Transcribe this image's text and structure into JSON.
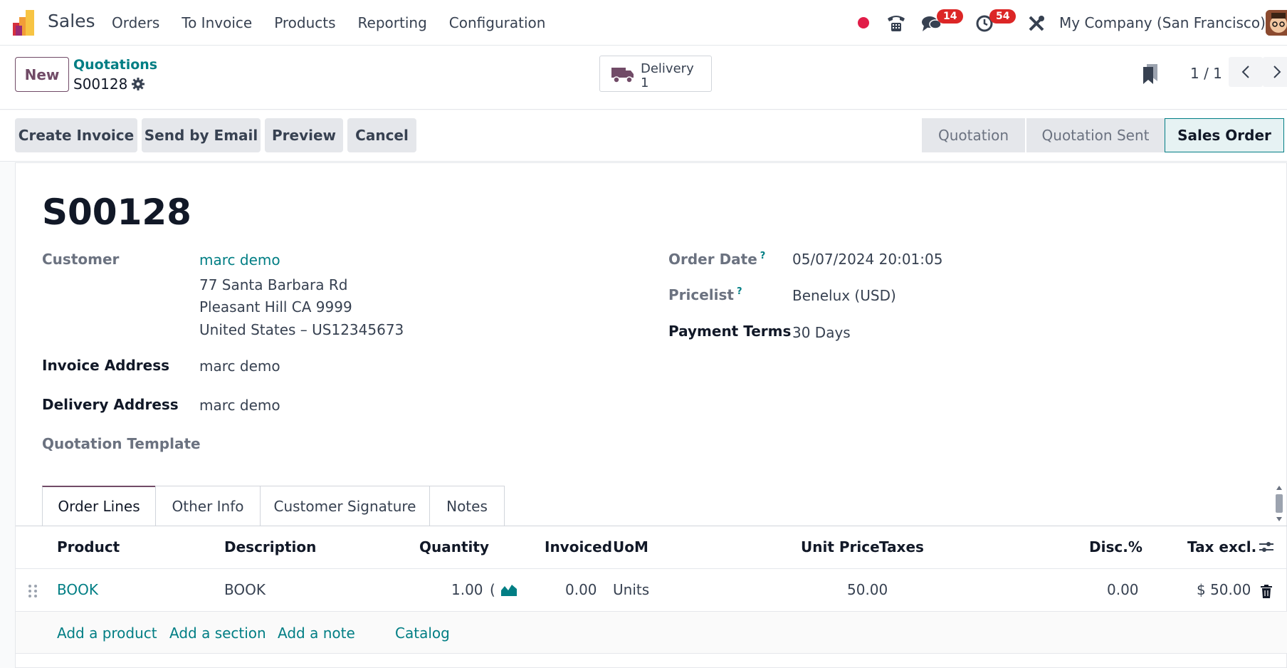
{
  "navbar": {
    "app_name": "Sales",
    "menu": [
      "Orders",
      "To Invoice",
      "Products",
      "Reporting",
      "Configuration"
    ],
    "messages_count": "14",
    "activities_count": "54",
    "company": "My Company (San Francisco)"
  },
  "control": {
    "new_label": "New",
    "breadcrumb_parent": "Quotations",
    "breadcrumb_current": "S00128",
    "delivery_label": "Delivery",
    "delivery_count": "1",
    "pager": "1 / 1"
  },
  "actions": {
    "create_invoice": "Create Invoice",
    "send_by_email": "Send by Email",
    "preview": "Preview",
    "cancel": "Cancel"
  },
  "status": {
    "stages": [
      "Quotation",
      "Quotation Sent",
      "Sales Order"
    ],
    "active": "Sales Order"
  },
  "record": {
    "name": "S00128",
    "customer_label": "Customer",
    "customer_name": "marc demo",
    "address_line1": "77 Santa Barbara Rd",
    "address_line2": "Pleasant Hill CA 9999",
    "address_line3": "United States – US12345673",
    "invoice_address_label": "Invoice Address",
    "invoice_address": "marc demo",
    "delivery_address_label": "Delivery Address",
    "delivery_address": "marc demo",
    "quotation_template_label": "Quotation Template",
    "order_date_label": "Order Date",
    "order_date": "05/07/2024 20:01:05",
    "pricelist_label": "Pricelist",
    "pricelist": "Benelux (USD)",
    "payment_terms_label": "Payment Terms",
    "payment_terms": "30 Days",
    "help_mark": "?"
  },
  "tabs": [
    "Order Lines",
    "Other Info",
    "Customer Signature",
    "Notes"
  ],
  "order_lines": {
    "columns": [
      "Product",
      "Description",
      "Quantity",
      "Invoiced",
      "UoM",
      "Unit Price",
      "Taxes",
      "Disc.%",
      "Tax excl."
    ],
    "rows": [
      {
        "product": "BOOK",
        "description": "BOOK",
        "quantity": "1.00",
        "quantity_suffix": "(",
        "invoiced": "0.00",
        "uom": "Units",
        "unit_price": "50.00",
        "taxes": "",
        "discount": "0.00",
        "subtotal": "$ 50.00"
      }
    ],
    "add_product": "Add a product",
    "add_section": "Add a section",
    "add_note": "Add a note",
    "catalog": "Catalog"
  },
  "colors": {
    "brand": "#714b67",
    "link": "#017e84",
    "badge": "#dc2626"
  }
}
